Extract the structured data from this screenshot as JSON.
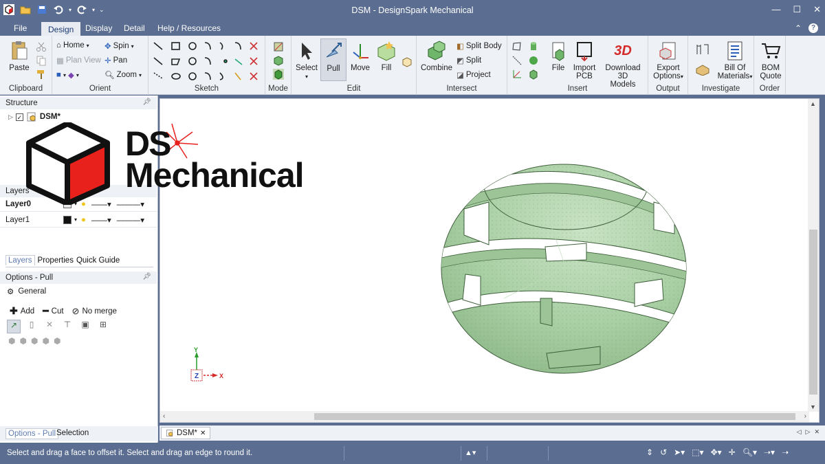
{
  "window": {
    "title": "DSM - DesignSpark Mechanical"
  },
  "menu": {
    "tabs": [
      "File",
      "Design",
      "Display",
      "Detail",
      "Help / Resources"
    ],
    "active": "Design"
  },
  "ribbon": {
    "clipboard": {
      "label": "Clipboard",
      "paste": "Paste"
    },
    "orient": {
      "label": "Orient",
      "home": "Home",
      "plan_view": "Plan View",
      "spin": "Spin",
      "pan": "Pan",
      "zoom": "Zoom"
    },
    "sketch": {
      "label": "Sketch"
    },
    "mode": {
      "label": "Mode"
    },
    "edit": {
      "label": "Edit",
      "select": "Select",
      "pull": "Pull",
      "move": "Move",
      "fill": "Fill"
    },
    "intersect": {
      "label": "Intersect",
      "combine": "Combine",
      "split_body": "Split Body",
      "split": "Split",
      "project": "Project"
    },
    "insert": {
      "label": "Insert",
      "file": "File",
      "import_pcb_1": "Import",
      "import_pcb_2": "PCB",
      "download_1": "Download 3D",
      "download_2": "Models",
      "logo_3d": "3D"
    },
    "output": {
      "label": "Output",
      "export_1": "Export",
      "export_2": "Options"
    },
    "investigate": {
      "label": "Investigate",
      "bom_1": "Bill Of",
      "bom_2": "Materials"
    },
    "order": {
      "label": "Order",
      "quote_1": "BOM",
      "quote_2": "Quote"
    }
  },
  "structure": {
    "header": "Structure",
    "root": "DSM*"
  },
  "layers": {
    "header": "Layers",
    "rows": [
      {
        "name": "Layer0",
        "bold": true
      },
      {
        "name": "Layer1",
        "bold": false
      }
    ]
  },
  "panel_tabs": [
    "Layers",
    "Properties",
    "Quick Guide"
  ],
  "options": {
    "header": "Options - Pull",
    "general": "General",
    "add": "Add",
    "cut": "Cut",
    "no_merge": "No merge"
  },
  "bottom_tabs": [
    "Options - Pull",
    "Selection"
  ],
  "doc_tab": "DSM*",
  "logo": {
    "line1": "DS",
    "line2": "Mechanical"
  },
  "triad": {
    "y": "Y",
    "z": "Z",
    "x": "X"
  },
  "status": {
    "message": "Select and drag a face to offset it. Select and drag an edge to round it."
  },
  "colors": {
    "titlebar": "#5b6e91",
    "model_fill": "#a9cfa4",
    "logo_red": "#e8211d"
  }
}
